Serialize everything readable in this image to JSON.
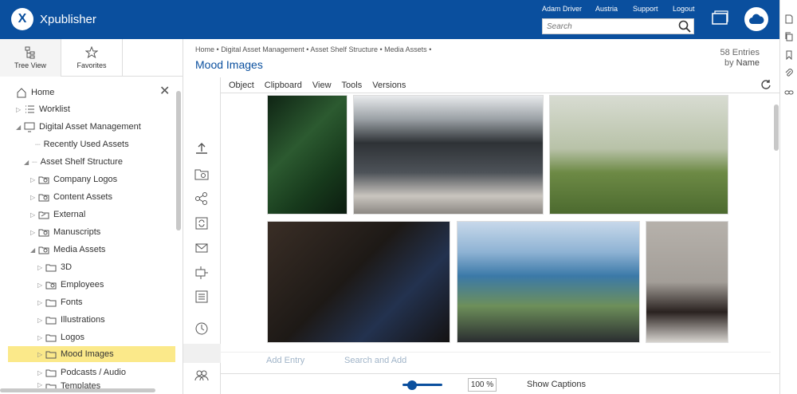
{
  "app": {
    "logo_letter": "X",
    "name": "Xpublisher",
    "brand_color": "#0a4f9e"
  },
  "header": {
    "nav": [
      "Adam Driver",
      "Austria",
      "Support",
      "Logout"
    ],
    "search_placeholder": "Search"
  },
  "left_tabs": [
    {
      "label": "Tree View",
      "icon": "tree-view-icon",
      "active": true
    },
    {
      "label": "Favorites",
      "icon": "star-icon",
      "active": false
    }
  ],
  "tree": [
    {
      "label": "Home",
      "icon": "home-icon"
    },
    {
      "label": "Worklist",
      "icon": "list-icon"
    },
    {
      "label": "Digital Asset Management",
      "icon": "monitor-icon"
    },
    {
      "label": "Recently Used Assets",
      "icon": "none"
    },
    {
      "label": "Asset Shelf Structure",
      "icon": "none"
    },
    {
      "label": "Company Logos",
      "icon": "shared-folder-icon"
    },
    {
      "label": "Content Assets",
      "icon": "shared-folder-icon"
    },
    {
      "label": "External",
      "icon": "link-folder-icon"
    },
    {
      "label": "Manuscripts",
      "icon": "shared-folder-icon"
    },
    {
      "label": "Media Assets",
      "icon": "shared-folder-icon"
    },
    {
      "label": "3D",
      "icon": "folder-icon"
    },
    {
      "label": "Employees",
      "icon": "shared-folder-icon"
    },
    {
      "label": "Fonts",
      "icon": "folder-icon"
    },
    {
      "label": "Illustrations",
      "icon": "folder-icon"
    },
    {
      "label": "Logos",
      "icon": "folder-icon"
    },
    {
      "label": "Mood Images",
      "icon": "folder-icon",
      "selected": true
    },
    {
      "label": "Podcasts / Audio",
      "icon": "folder-icon"
    },
    {
      "label": "Templates",
      "icon": "folder-icon"
    }
  ],
  "breadcrumb": [
    "Home",
    "Digital Asset Management",
    "Asset Shelf Structure",
    "Media Assets"
  ],
  "page_title": "Mood Images",
  "entries": {
    "count_text": "58 Entries",
    "by": "by",
    "sort": "Name"
  },
  "toolbar": [
    "Object",
    "Clipboard",
    "View",
    "Tools",
    "Versions"
  ],
  "images": [
    {
      "name": "leaves-image",
      "color": "#1f3b22"
    },
    {
      "name": "cockpit-image",
      "color": "#4a4f55"
    },
    {
      "name": "dog-image",
      "color": "#6e7f4a"
    },
    {
      "name": "man-suit-image",
      "color": "#2a2624"
    },
    {
      "name": "helicopter-view-image",
      "color": "#3d6b8f"
    },
    {
      "name": "person-sitting-image",
      "color": "#9a9590"
    }
  ],
  "add_bar": {
    "add_entry": "Add Entry",
    "search_add": "Search and Add"
  },
  "bottom": {
    "zoom": "100 %",
    "captions": "Show Captions"
  }
}
